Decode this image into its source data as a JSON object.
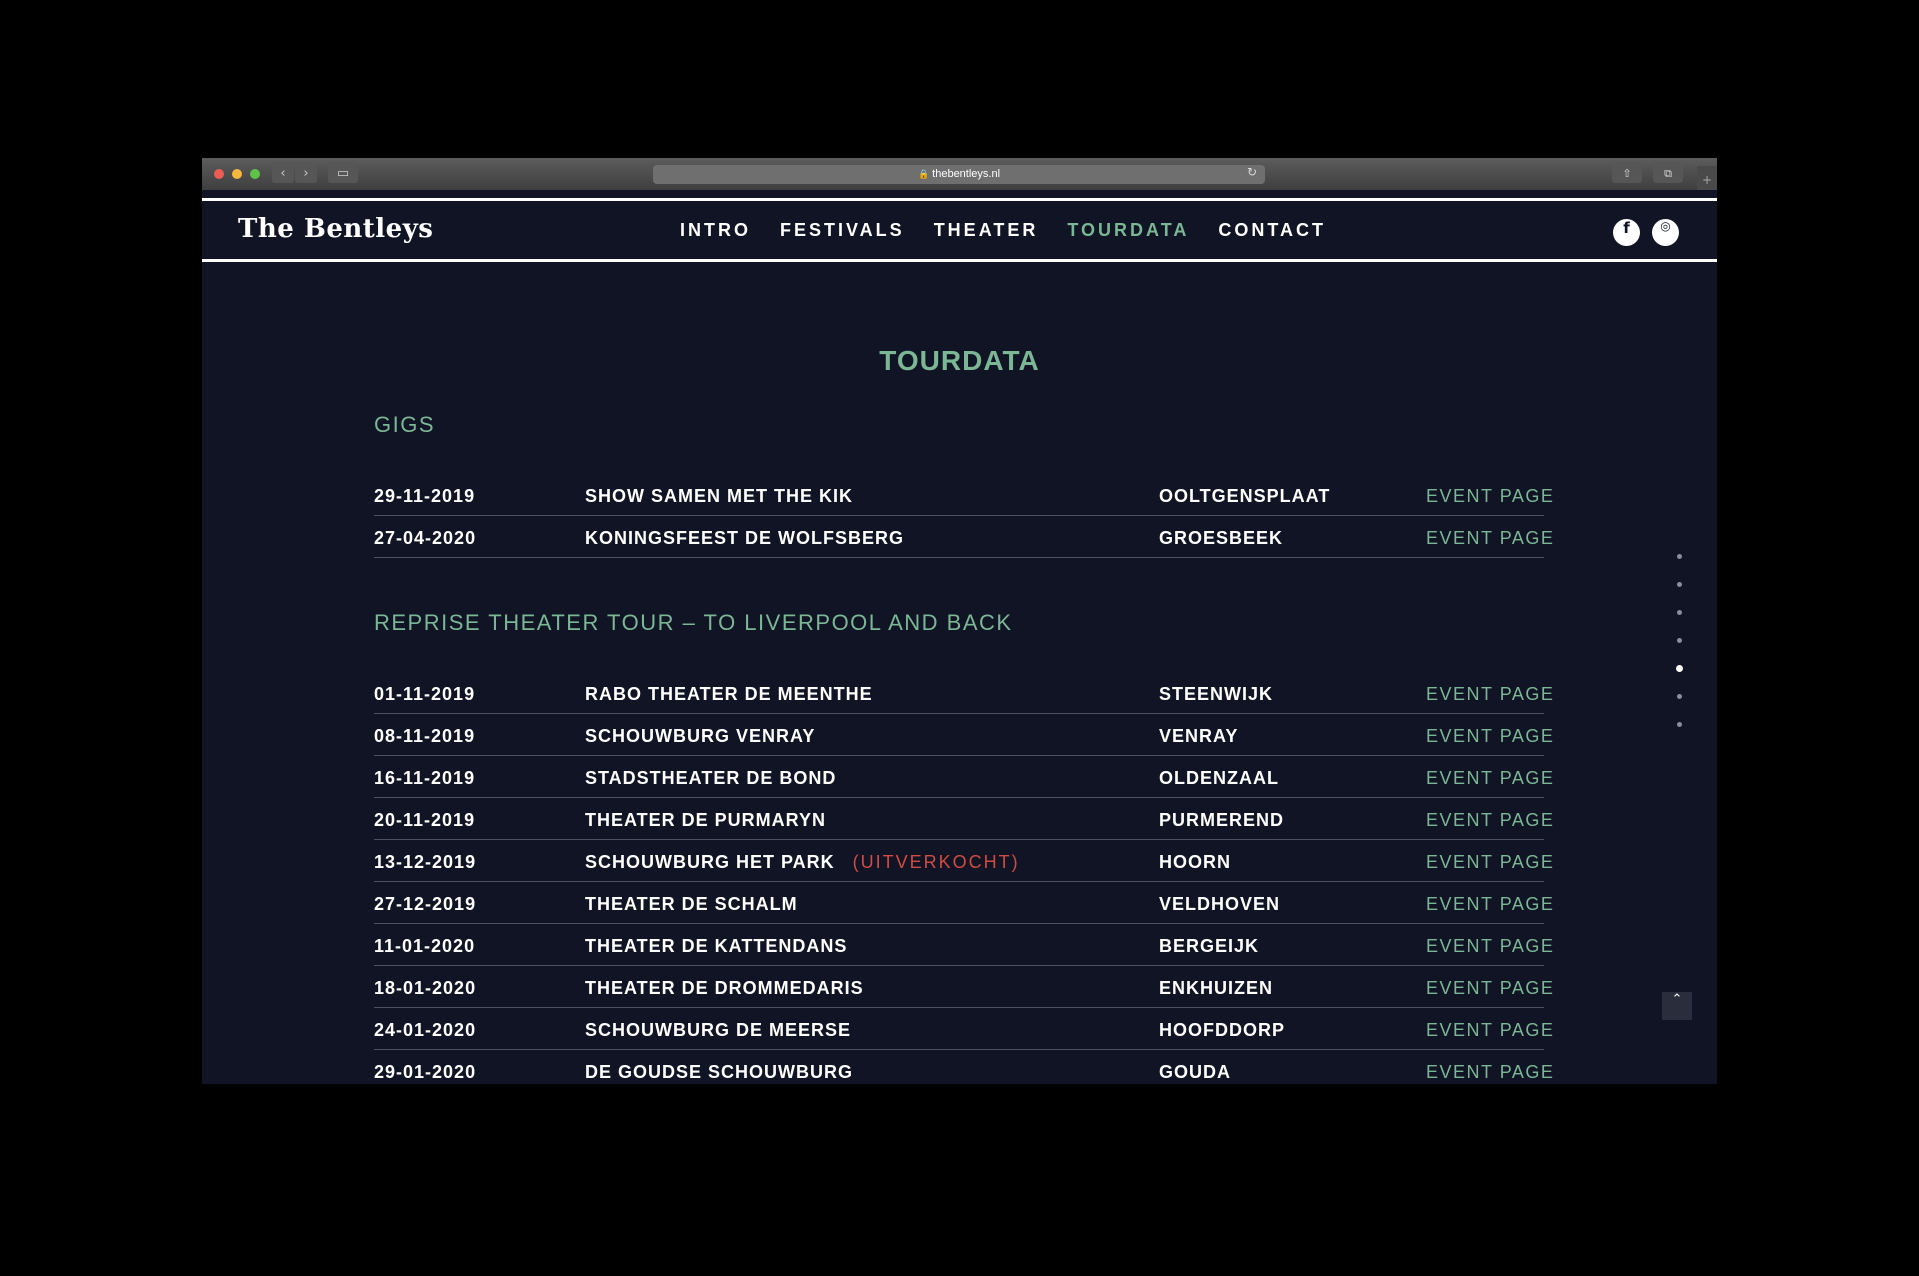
{
  "browser": {
    "url": "thebentleys.nl",
    "lock_icon": "🔒",
    "reload_icon": "↻",
    "back_icon": "‹",
    "forward_icon": "›",
    "sidebar_icon": "▭",
    "share_icon": "⇧",
    "tabs_icon": "⧉",
    "newtab_icon": "+",
    "traffic_colors": [
      "#ee5d52",
      "#f5b83f",
      "#5ec447"
    ]
  },
  "site": {
    "logo": "The Bentleys",
    "nav": [
      {
        "label": "INTRO",
        "active": false
      },
      {
        "label": "FESTIVALS",
        "active": false
      },
      {
        "label": "THEATER",
        "active": false
      },
      {
        "label": "TOURDATA",
        "active": true
      },
      {
        "label": "CONTACT",
        "active": false
      }
    ],
    "social": {
      "facebook": "f",
      "instagram": "◎"
    }
  },
  "page": {
    "title": "TOURDATA",
    "back_to_top_icon": "⌃"
  },
  "gigs": {
    "title": "GIGS",
    "rows": [
      {
        "date": "29-11-2019",
        "venue": "SHOW SAMEN MET THE KIK",
        "city": "OOLTGENSPLAAT",
        "link": "EVENT PAGE"
      },
      {
        "date": "27-04-2020",
        "venue": "KONINGSFEEST DE WOLFSBERG",
        "city": "GROESBEEK",
        "link": "EVENT PAGE"
      }
    ]
  },
  "tour": {
    "title": "REPRISE THEATER TOUR – TO LIVERPOOL AND BACK",
    "rows": [
      {
        "date": "01-11-2019",
        "venue": "RABO THEATER DE MEENTHE",
        "tag": "",
        "city": "STEENWIJK",
        "link": "EVENT PAGE"
      },
      {
        "date": "08-11-2019",
        "venue": "SCHOUWBURG VENRAY",
        "tag": "",
        "city": "VENRAY",
        "link": "EVENT PAGE"
      },
      {
        "date": "16-11-2019",
        "venue": "STADSTHEATER DE BOND",
        "tag": "",
        "city": "OLDENZAAL",
        "link": "EVENT PAGE"
      },
      {
        "date": "20-11-2019",
        "venue": "THEATER DE PURMARYN",
        "tag": "",
        "city": "PURMEREND",
        "link": "EVENT PAGE"
      },
      {
        "date": "13-12-2019",
        "venue": "SCHOUWBURG HET PARK",
        "tag": "(UITVERKOCHT)",
        "city": "HOORN",
        "link": "EVENT PAGE"
      },
      {
        "date": "27-12-2019",
        "venue": "THEATER DE SCHALM",
        "tag": "",
        "city": "VELDHOVEN",
        "link": "EVENT PAGE"
      },
      {
        "date": "11-01-2020",
        "venue": "THEATER DE KATTENDANS",
        "tag": "",
        "city": "BERGEIJK",
        "link": "EVENT PAGE"
      },
      {
        "date": "18-01-2020",
        "venue": "THEATER DE DROMMEDARIS",
        "tag": "",
        "city": "ENKHUIZEN",
        "link": "EVENT PAGE"
      },
      {
        "date": "24-01-2020",
        "venue": "SCHOUWBURG DE MEERSE",
        "tag": "",
        "city": "HOOFDDORP",
        "link": "EVENT PAGE"
      },
      {
        "date": "29-01-2020",
        "venue": "DE GOUDSE SCHOUWBURG",
        "tag": "",
        "city": "GOUDA",
        "link": "EVENT PAGE"
      }
    ]
  },
  "section_dots": {
    "count": 7,
    "active_index": 4
  },
  "colors": {
    "accent": "#7bb795",
    "sold_out": "#d24b41",
    "background": "#111424"
  }
}
